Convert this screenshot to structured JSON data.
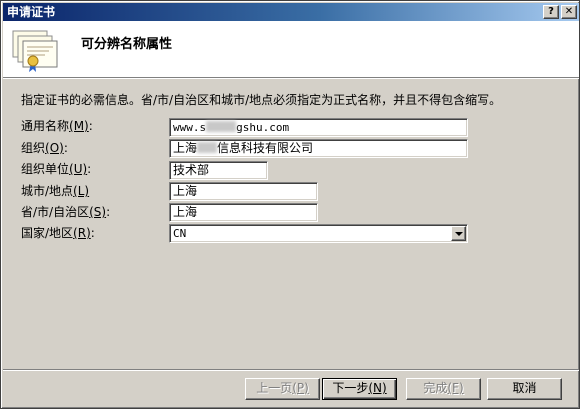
{
  "window": {
    "title": "申请证书"
  },
  "titlebar": {
    "help_glyph": "?",
    "close_glyph": "✕"
  },
  "header": {
    "title": "可分辨名称属性"
  },
  "description": "指定证书的必需信息。省/市/自治区和城市/地点必须指定为正式名称，并且不得包含缩写。",
  "fields": {
    "common_name": {
      "label": "通用名称",
      "access_key": "(M)",
      "suffix": ":",
      "value_prefix": "www.s",
      "value_suffix": "gshu.com"
    },
    "organization": {
      "label": "组织",
      "access_key": "(O)",
      "suffix": ":",
      "value_prefix": "上海",
      "value_suffix": "信息科技有限公司"
    },
    "org_unit": {
      "label": "组织单位",
      "access_key": "(U)",
      "suffix": ":",
      "value": "技术部"
    },
    "city": {
      "label": "城市/地点",
      "access_key": "(L)",
      "suffix": "",
      "value": "上海"
    },
    "province": {
      "label": "省/市/自治区",
      "access_key": "(S)",
      "suffix": ":",
      "value": "上海"
    },
    "country": {
      "label": "国家/地区",
      "access_key": "(R)",
      "suffix": ":",
      "value": "CN"
    }
  },
  "buttons": {
    "back": {
      "label": "上一页",
      "access_key": "(P)"
    },
    "next": {
      "label": "下一步",
      "access_key": "(N)"
    },
    "finish": {
      "label": "完成",
      "access_key": "(F)"
    },
    "cancel": {
      "label": "取消"
    }
  }
}
